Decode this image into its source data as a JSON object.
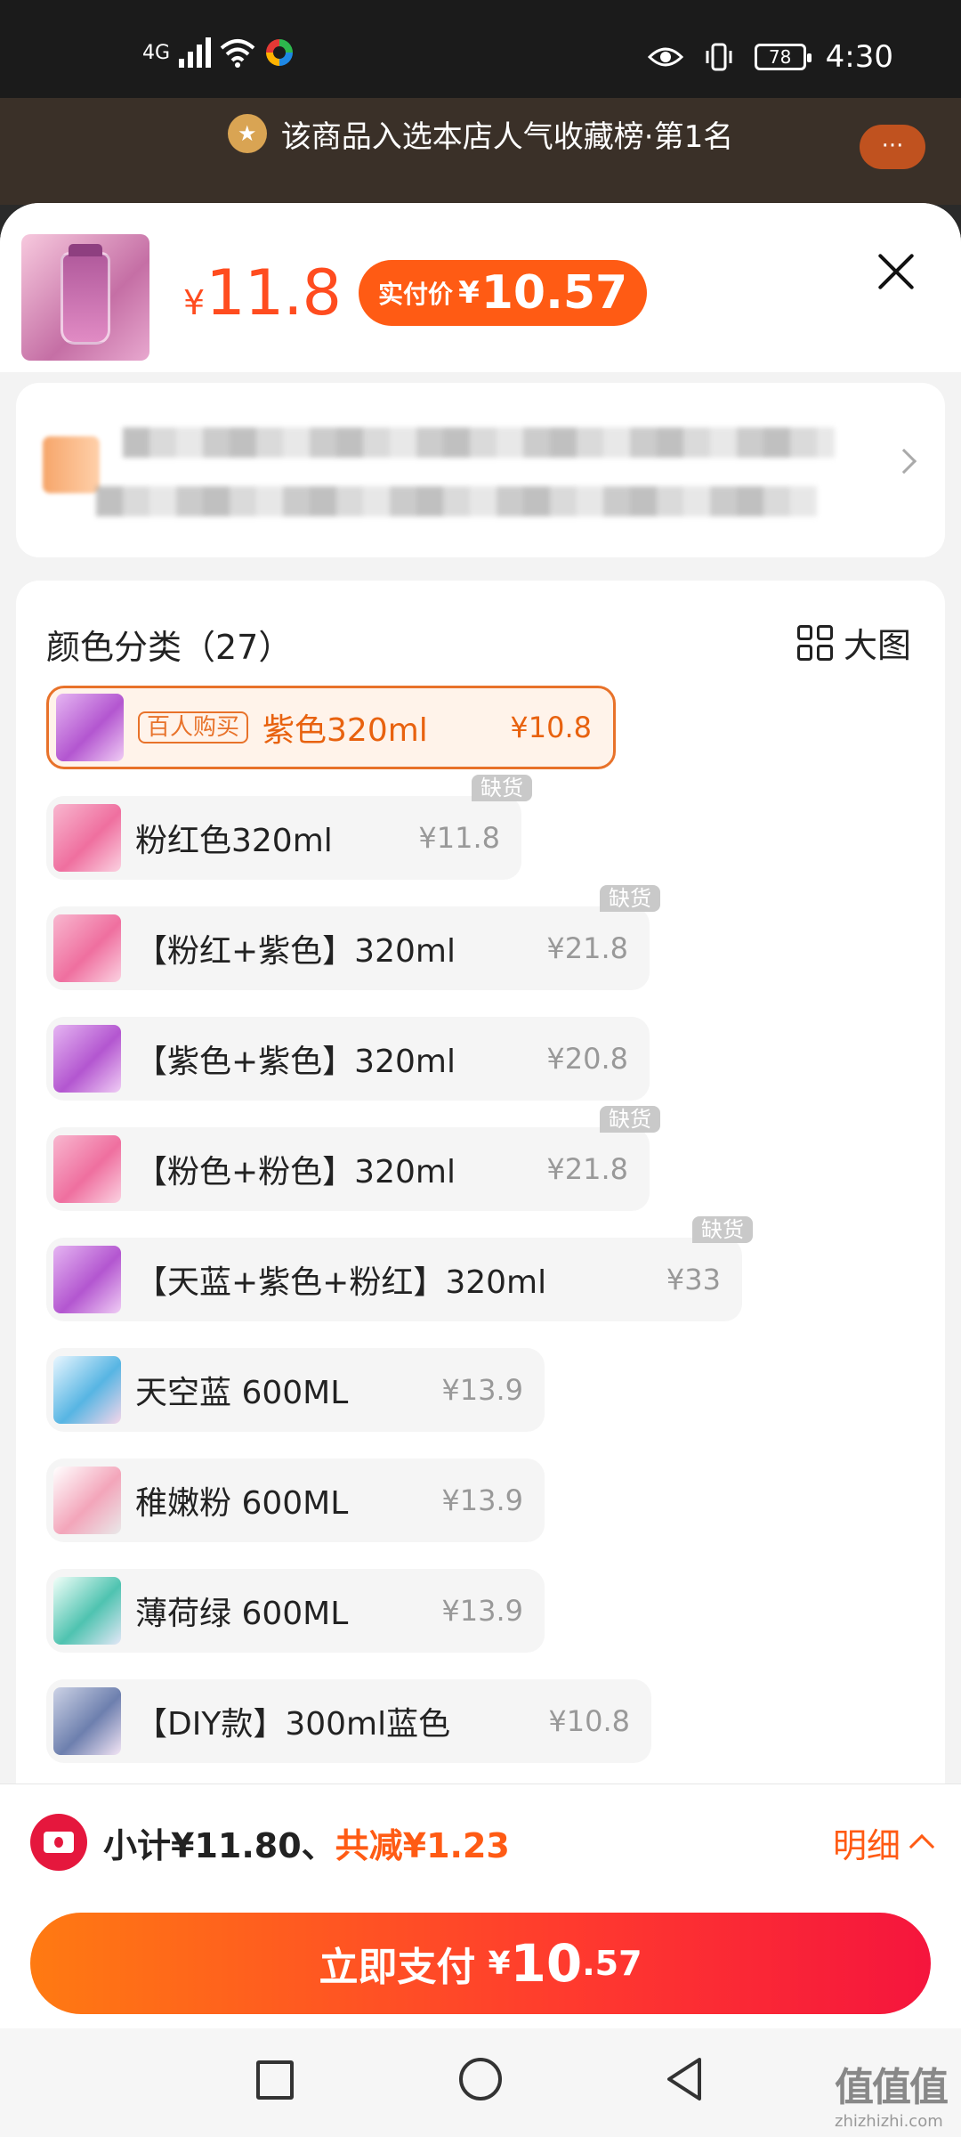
{
  "status_bar": {
    "network": "4G",
    "battery": "78",
    "time": "4:30"
  },
  "banner": {
    "text": "该商品入选本店人气收藏榜·第1名",
    "more_label": "···"
  },
  "product": {
    "currency": "¥",
    "price": "11.8",
    "pay_label": "实付价",
    "pay_price": "10.57"
  },
  "variants": {
    "title": "颜色分类（27）",
    "big_view_label": "大图",
    "out_of_stock_label": "缺货",
    "hot_tag": "百人购买",
    "items": [
      {
        "name": "紫色320ml",
        "price": "¥10.8"
      },
      {
        "name": "粉红色320ml",
        "price": "¥11.8"
      },
      {
        "name": "【粉红+紫色】320ml",
        "price": "¥21.8"
      },
      {
        "name": "【紫色+紫色】320ml",
        "price": "¥20.8"
      },
      {
        "name": "【粉色+粉色】320ml",
        "price": "¥21.8"
      },
      {
        "name": "【天蓝+紫色+粉红】320ml",
        "price": "¥33"
      },
      {
        "name": "天空蓝 600ML",
        "price": "¥13.9"
      },
      {
        "name": "稚嫩粉 600ML",
        "price": "¥13.9"
      },
      {
        "name": "薄荷绿 600ML",
        "price": "¥13.9"
      },
      {
        "name": "【DIY款】300ml蓝色",
        "price": "¥10.8"
      }
    ]
  },
  "footer": {
    "subtotal": "小计¥11.80、",
    "saving": "共减¥1.23",
    "detail_label": "明细",
    "pay_label": "立即支付",
    "pay_currency": "¥",
    "pay_int": "10",
    "pay_dec": ".57"
  },
  "watermark": {
    "text": "值值值",
    "url": "zhizhizhi.com"
  },
  "colors": {
    "accent": "#ff5b14",
    "pay_gradient_end": "#f5153d"
  }
}
